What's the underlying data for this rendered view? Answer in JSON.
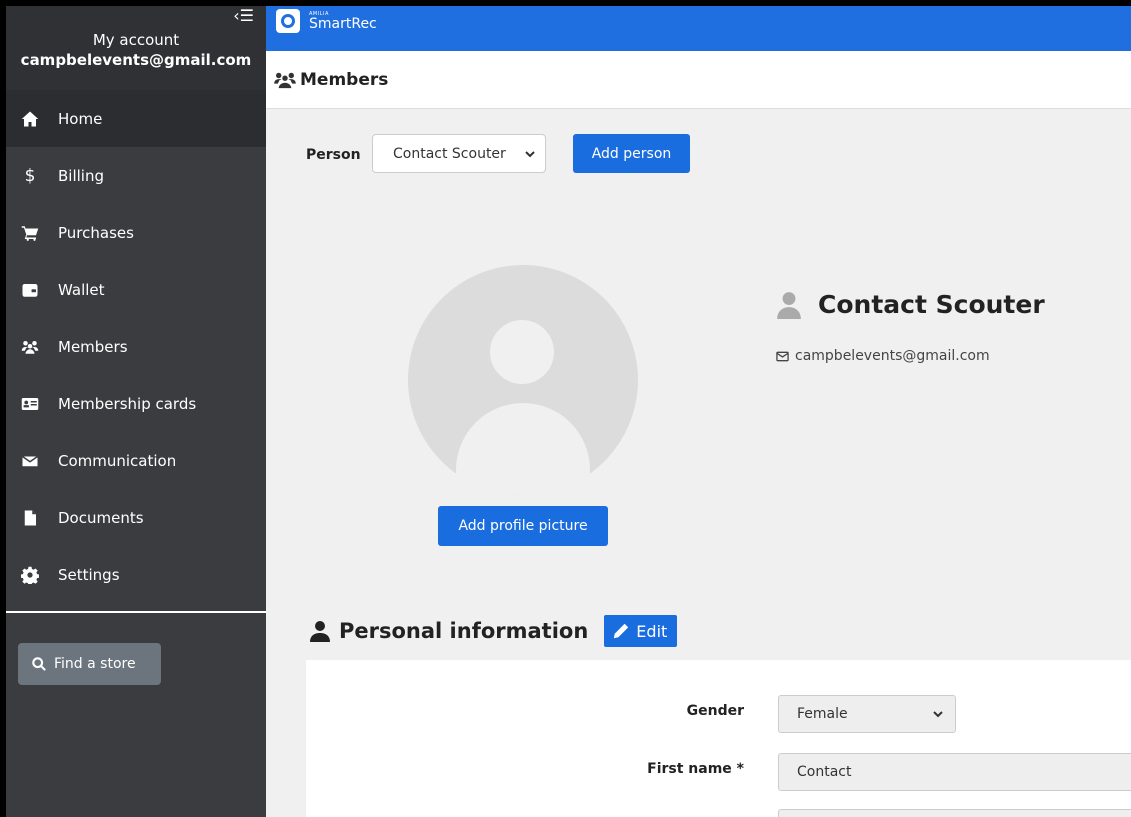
{
  "sidebar": {
    "account_title": "My account",
    "account_email": "campbelevents@gmail.com",
    "items": [
      {
        "label": "Home",
        "icon": "home-icon"
      },
      {
        "label": "Billing",
        "icon": "dollar-icon"
      },
      {
        "label": "Purchases",
        "icon": "cart-icon"
      },
      {
        "label": "Wallet",
        "icon": "wallet-icon"
      },
      {
        "label": "Members",
        "icon": "users-icon"
      },
      {
        "label": "Membership cards",
        "icon": "id-card-icon"
      },
      {
        "label": "Communication",
        "icon": "envelope-icon"
      },
      {
        "label": "Documents",
        "icon": "file-icon"
      },
      {
        "label": "Settings",
        "icon": "gear-icon"
      }
    ],
    "find_store_label": "Find a store"
  },
  "topbar": {
    "logo_small": "AMILIA",
    "logo_text": "SmartRec"
  },
  "page": {
    "title": "Members"
  },
  "person": {
    "label": "Person",
    "selected": "Contact Scouter",
    "add_button": "Add person"
  },
  "profile": {
    "add_picture_button": "Add profile picture",
    "name": "Contact Scouter",
    "email": "campbelevents@gmail.com"
  },
  "personal_info": {
    "title": "Personal information",
    "edit_button": "Edit",
    "gender_label": "Gender",
    "gender_value": "Female",
    "first_name_label": "First name *",
    "first_name_value": "Contact"
  },
  "colors": {
    "primary": "#1a6ddf",
    "sidebar": "#3a3c3f"
  }
}
